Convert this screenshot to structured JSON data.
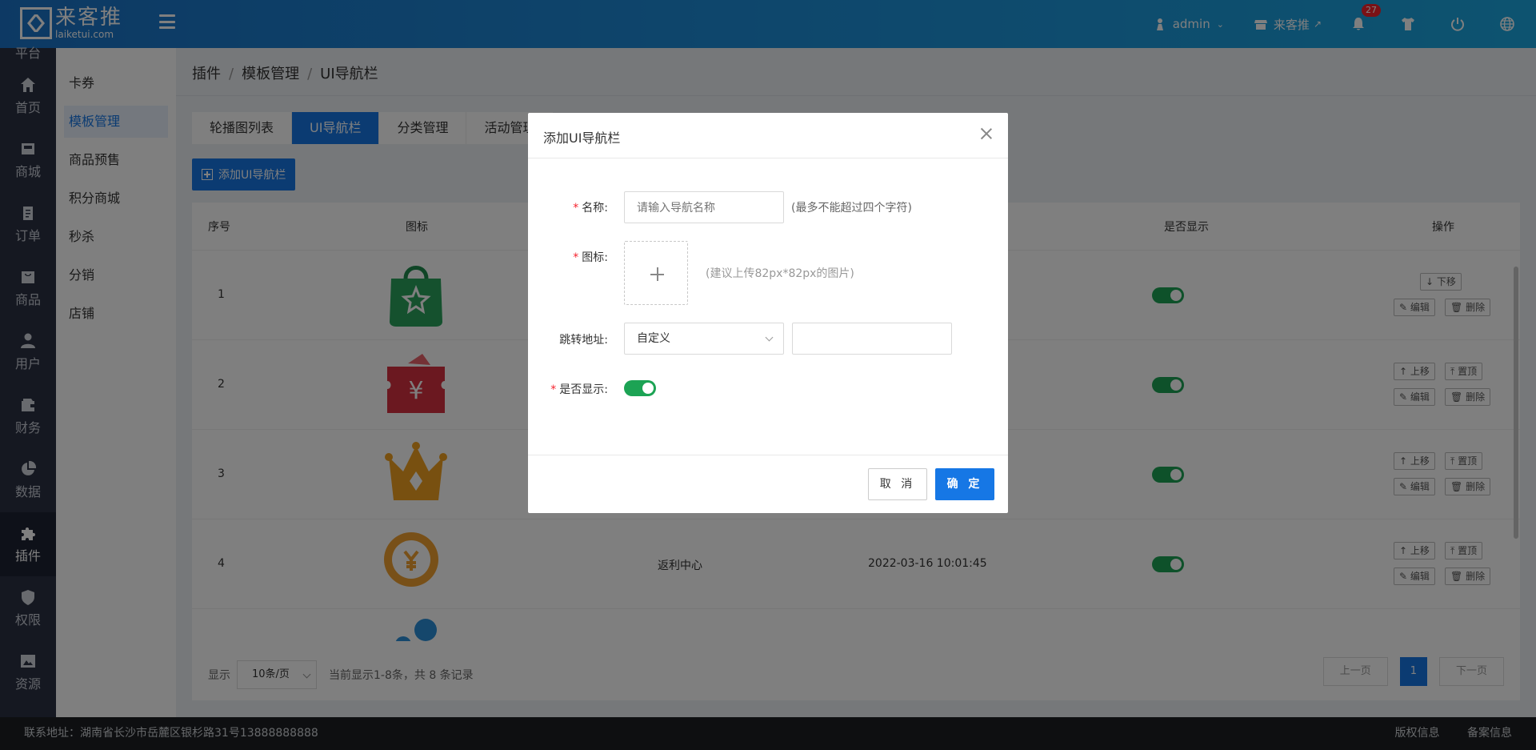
{
  "header": {
    "logo_text": "来客推",
    "logo_sub": "laiketui.com",
    "user": "admin",
    "store": "来客推",
    "notifications": "27"
  },
  "sidebar1": {
    "top_partial": "平台",
    "items": [
      {
        "label": "首页",
        "icon": "home-icon"
      },
      {
        "label": "商城",
        "icon": "mall-icon"
      },
      {
        "label": "订单",
        "icon": "order-icon"
      },
      {
        "label": "商品",
        "icon": "goods-icon"
      },
      {
        "label": "用户",
        "icon": "user-icon"
      },
      {
        "label": "财务",
        "icon": "wallet-icon"
      },
      {
        "label": "数据",
        "icon": "chart-icon"
      },
      {
        "label": "插件",
        "icon": "puzzle-icon"
      },
      {
        "label": "权限",
        "icon": "shield-icon"
      },
      {
        "label": "资源",
        "icon": "image-icon"
      }
    ]
  },
  "sidebar2": {
    "items": [
      "卡券",
      "模板管理",
      "商品预售",
      "积分商城",
      "秒杀",
      "分销",
      "店铺"
    ]
  },
  "breadcrumb": [
    "插件",
    "模板管理",
    "UI导航栏"
  ],
  "tabs": [
    "轮播图列表",
    "UI导航栏",
    "分类管理",
    "活动管理"
  ],
  "add_button": "添加UI导航栏",
  "table": {
    "headers": {
      "index": "序号",
      "icon": "图标",
      "show": "是否显示",
      "ops": "操作"
    },
    "rows": [
      {
        "index": "1",
        "name": "",
        "time": ""
      },
      {
        "index": "2",
        "name": "",
        "time": ""
      },
      {
        "index": "3",
        "name": "",
        "time": ""
      },
      {
        "index": "4",
        "name": "返利中心",
        "time": "2022-03-16 10:01:45"
      }
    ],
    "ops": {
      "down": "下移",
      "up": "上移",
      "top": "置顶",
      "edit": "编辑",
      "delete": "删除"
    }
  },
  "pager": {
    "show": "显示",
    "size": "10条/页",
    "summary": "当前显示1-8条，共 8 条记录",
    "prev": "上一页",
    "page": "1",
    "next": "下一页"
  },
  "footer": {
    "address": "联系地址：湖南省长沙市岳麓区银杉路31号13888888888",
    "copyright": "版权信息",
    "record": "备案信息"
  },
  "modal": {
    "title": "添加UI导航栏",
    "name_label": "名称:",
    "name_placeholder": "请输入导航名称",
    "name_hint": "(最多不能超过四个字符)",
    "icon_label": "图标:",
    "icon_hint": "(建议上传82px*82px的图片)",
    "link_label": "跳转地址:",
    "link_select": "自定义",
    "show_label": "是否显示:",
    "cancel": "取 消",
    "ok": "确 定"
  }
}
